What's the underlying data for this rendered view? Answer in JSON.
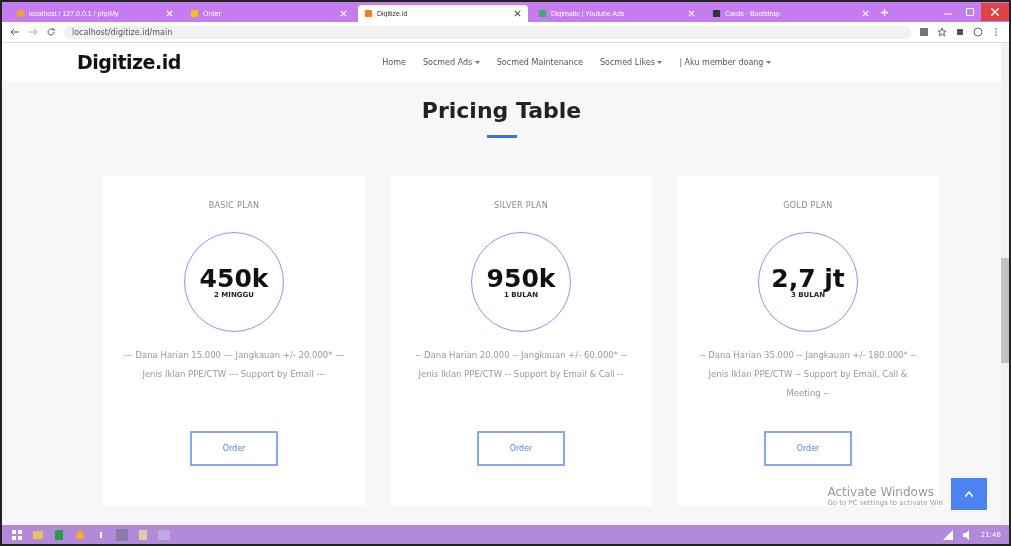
{
  "browser": {
    "tabs": [
      {
        "title": "localhost / 127.0.0.1 / phpMy",
        "selected": false
      },
      {
        "title": "Order",
        "selected": false
      },
      {
        "title": "Digitize.id",
        "selected": true
      },
      {
        "title": "Digimatic | Youtube Ads",
        "selected": false
      },
      {
        "title": "Cards · Bootstrap",
        "selected": false
      }
    ],
    "url": "localhost/digitize.id/main"
  },
  "navbar": {
    "brand": "Digitize.id",
    "items": [
      {
        "label": "Home",
        "dropdown": false
      },
      {
        "label": "Socmed Ads",
        "dropdown": true
      },
      {
        "label": "Socmed Maintenance",
        "dropdown": false
      },
      {
        "label": "Socmed Likes",
        "dropdown": true
      },
      {
        "label": "| Aku member doang",
        "dropdown": true
      }
    ]
  },
  "section_title": "Pricing Table",
  "plans": [
    {
      "name": "BASIC PLAN",
      "price": "450k",
      "period": "2 MINGGU",
      "description": "--- Dana Harian 15.000 --- Jangkauan +/- 20.000* --- Jenis Iklan PPE/CTW --- Support by Email ---",
      "button": "Order"
    },
    {
      "name": "SILVER PLAN",
      "price": "950k",
      "period": "1 BULAN",
      "description": "-- Dana Harian 20.000 -- Jangkauan +/- 60.000* -- Jenis Iklan PPE/CTW -- Support by Email & Call --",
      "button": "Order"
    },
    {
      "name": "GOLD PLAN",
      "price": "2,7 jt",
      "period": "3 BULAN",
      "description": "-- Dana Harian 35.000 -- Jangkauan +/- 180.000* -- Jenis Iklan PPE/CTW -- Support by Email, Call & Meeting --",
      "button": "Order"
    }
  ],
  "activation_notice": {
    "title": "Activate Windows",
    "text": "Go to PC settings to activate Win"
  },
  "taskbar": {
    "time": "21:46"
  }
}
